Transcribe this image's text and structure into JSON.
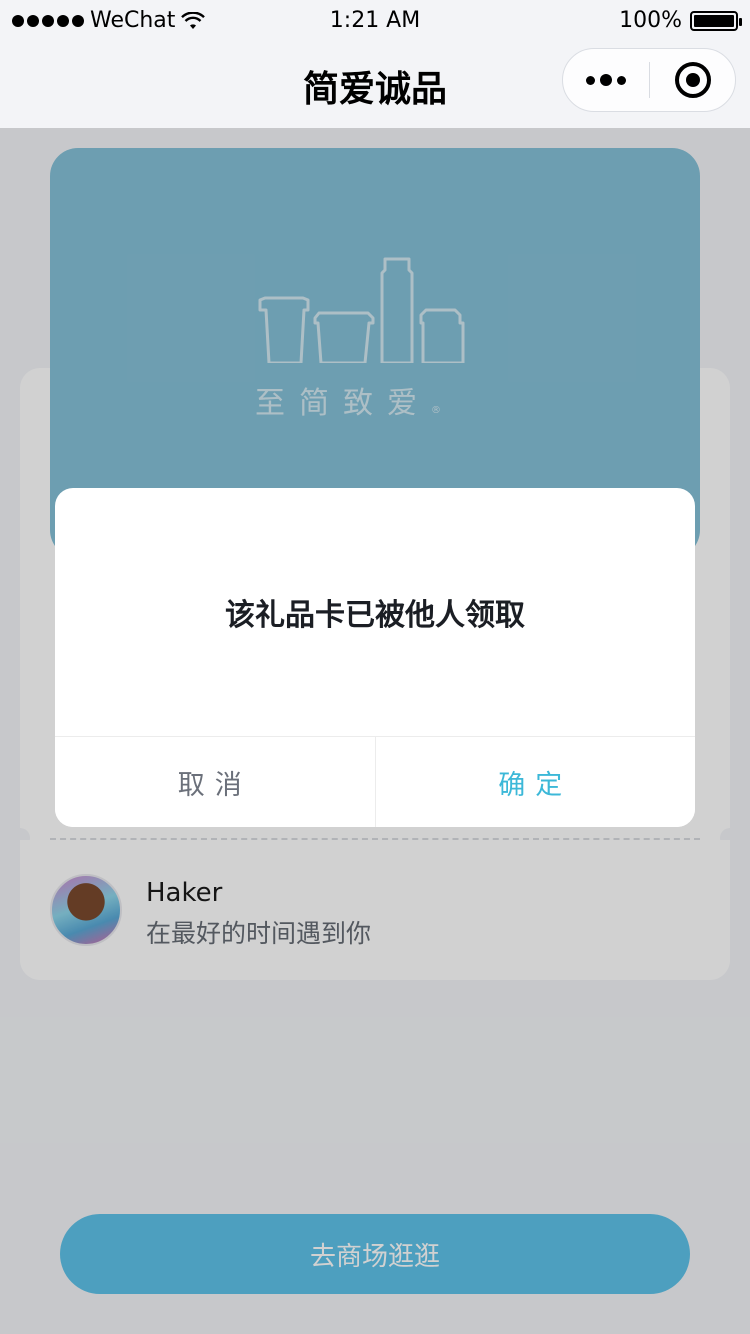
{
  "status_bar": {
    "carrier": "WeChat",
    "time": "1:21 AM",
    "battery": "100%"
  },
  "nav": {
    "title": "简爱诚品"
  },
  "gift_card": {
    "slogan": "至简致爱",
    "registered_mark": "®"
  },
  "user": {
    "name": "Haker",
    "message": "在最好的时间遇到你"
  },
  "shop_button": {
    "label": "去商场逛逛"
  },
  "modal": {
    "message": "该礼品卡已被他人领取",
    "cancel_label": "取消",
    "confirm_label": "确定"
  },
  "colors": {
    "accent": "#3cb8d8",
    "card": "#86c1d8",
    "button": "#5ec3e9"
  }
}
